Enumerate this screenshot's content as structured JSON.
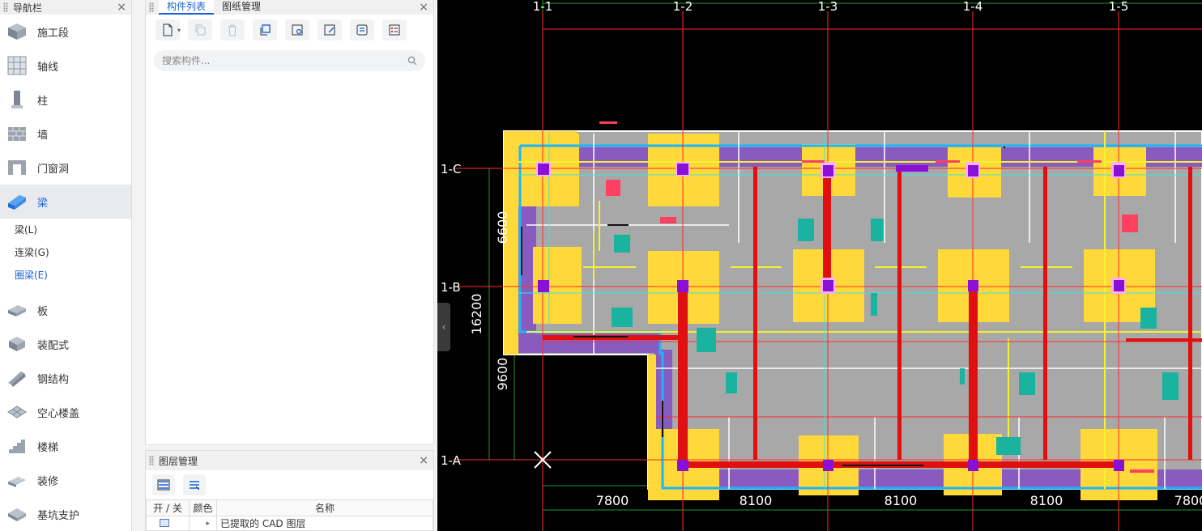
{
  "nav": {
    "title": "导航栏",
    "close": "×",
    "items": [
      {
        "label": "施工段",
        "icon": "construction-segment-icon"
      },
      {
        "label": "轴线",
        "icon": "grid-axis-icon"
      },
      {
        "label": "柱",
        "icon": "column-icon"
      },
      {
        "label": "墙",
        "icon": "wall-icon"
      },
      {
        "label": "门窗洞",
        "icon": "door-window-icon"
      },
      {
        "label": "梁",
        "icon": "beam-icon"
      },
      {
        "label": "板",
        "icon": "slab-icon"
      },
      {
        "label": "装配式",
        "icon": "prefab-icon"
      },
      {
        "label": "钢结构",
        "icon": "steel-structure-icon"
      },
      {
        "label": "空心楼盖",
        "icon": "hollow-floor-icon"
      },
      {
        "label": "楼梯",
        "icon": "stairs-icon"
      },
      {
        "label": "装修",
        "icon": "decoration-icon"
      },
      {
        "label": "基坑支护",
        "icon": "foundation-pit-icon"
      }
    ],
    "sub_items": [
      "梁(L)",
      "连梁(G)",
      "圈梁(E)"
    ]
  },
  "component_panel": {
    "tabs": [
      "构件列表",
      "图纸管理"
    ],
    "close": "×",
    "search_placeholder": "搜索构件..."
  },
  "layer_panel": {
    "title": "图层管理",
    "close": "×",
    "columns": [
      "开 / 关",
      "颜色",
      "名称"
    ],
    "rows": [
      {
        "name": "已提取的 CAD 图层"
      }
    ]
  },
  "cad": {
    "axis_top": [
      "1-1",
      "1-2",
      "1-3",
      "1-4",
      "1-5"
    ],
    "axis_left": [
      "1-C",
      "1-B",
      "1-A"
    ],
    "dims_bottom": [
      "7800",
      "8100",
      "8100",
      "8100",
      "7800"
    ],
    "dims_left": [
      "6600",
      "16200",
      "9600"
    ],
    "colors": {
      "background": "#000000",
      "slab": "#a8a8a8",
      "column_pad": "#ffd83a",
      "beam": "#e01010",
      "column": "#8a10d8",
      "grid": "#ff2b2b",
      "outline": "#ffffff",
      "edge": "#1ab6ff"
    }
  }
}
